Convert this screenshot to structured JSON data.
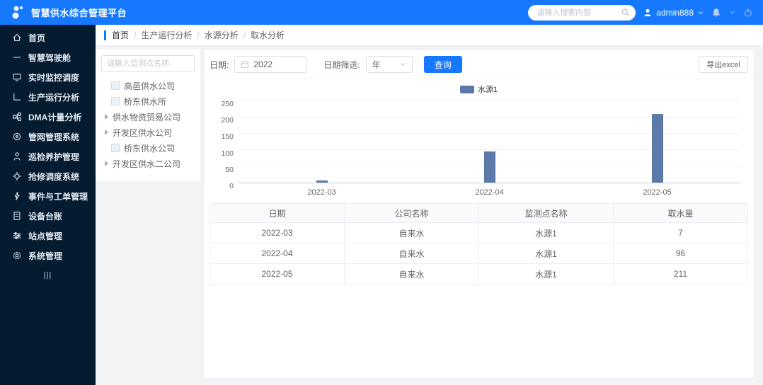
{
  "header": {
    "app_title": "智慧供水综合管理平台",
    "search_placeholder": "请输入搜索内容",
    "username": "admin888"
  },
  "sidebar": {
    "collapse_label": "|||",
    "items": [
      {
        "label": "首页",
        "icon": "home-icon"
      },
      {
        "label": "智慧驾驶舱",
        "icon": "dashboard-icon"
      },
      {
        "label": "实时监控调度",
        "icon": "monitor-icon"
      },
      {
        "label": "生产运行分析",
        "icon": "production-chart-icon"
      },
      {
        "label": "DMA计量分析",
        "icon": "dma-metering-icon"
      },
      {
        "label": "管网管理系统",
        "icon": "pipe-network-icon"
      },
      {
        "label": "巡检养护管理",
        "icon": "patrol-person-icon"
      },
      {
        "label": "抢修调度系统",
        "icon": "repair-dispatch-icon"
      },
      {
        "label": "事件与工单管理",
        "icon": "event-workorder-icon"
      },
      {
        "label": "设备台账",
        "icon": "device-ledger-icon"
      },
      {
        "label": "站点管理",
        "icon": "station-sliders-icon"
      },
      {
        "label": "系统管理",
        "icon": "system-gear-icon"
      }
    ]
  },
  "breadcrumb": {
    "items": [
      "首页",
      "生产运行分析",
      "水源分析",
      "取水分析"
    ],
    "separator": "/"
  },
  "tree_panel": {
    "search_placeholder": "请输入监测点名称",
    "items": [
      {
        "label": "高邑供水公司",
        "type": "checkbox",
        "indent": 1
      },
      {
        "label": "桥东供水所",
        "type": "checkbox",
        "indent": 1
      },
      {
        "label": "供水物资贸易公司",
        "type": "expand",
        "indent": 0
      },
      {
        "label": "开发区供水公司",
        "type": "expand",
        "indent": 0
      },
      {
        "label": "桥东供水公司",
        "type": "checkbox",
        "indent": 1
      },
      {
        "label": "开发区供水二公司",
        "type": "expand",
        "indent": 0
      }
    ]
  },
  "toolbar": {
    "date_label": "日期:",
    "date_value": "2022",
    "filter_label": "日期筛选:",
    "filter_value": "年",
    "query_label": "查询",
    "export_label": "导出excel"
  },
  "chart_data": {
    "type": "bar",
    "title": "",
    "categories": [
      "2022-03",
      "2022-04",
      "2022-05"
    ],
    "series": [
      {
        "name": "水源1",
        "values": [
          7,
          96,
          211
        ]
      }
    ],
    "ylim": [
      0,
      250
    ],
    "yticks": [
      0,
      50,
      100,
      150,
      200,
      250
    ],
    "grid": true,
    "legend_position": "top",
    "bar_color": "#5b7aa9"
  },
  "table": {
    "headers": [
      "日期",
      "公司名称",
      "监测点名称",
      "取水量"
    ],
    "rows": [
      [
        "2022-03",
        "自来水",
        "水源1",
        "7"
      ],
      [
        "2022-04",
        "自来水",
        "水源1",
        "96"
      ],
      [
        "2022-05",
        "自来水",
        "水源1",
        "211"
      ]
    ]
  },
  "colors": {
    "header_bg": "#1677ff",
    "sidebar_bg": "#041b30",
    "accent": "#1677ff",
    "bar": "#5b7aa9"
  }
}
